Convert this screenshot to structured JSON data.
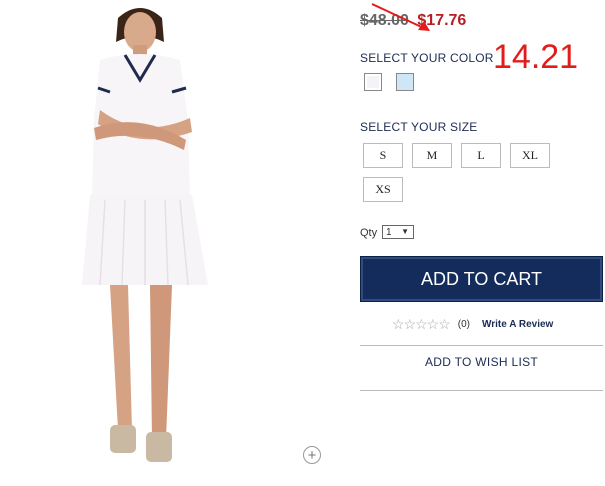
{
  "price": {
    "original": "$48.00",
    "sale": "$17.76"
  },
  "annotation": {
    "text": "14.21",
    "color": "#e21b1b"
  },
  "colors": {
    "label": "SELECT YOUR COLOR",
    "swatches": [
      {
        "name": "white",
        "hex": "#f3f4f8"
      },
      {
        "name": "light blue",
        "hex": "#cfe6f7"
      }
    ]
  },
  "sizes": {
    "label": "SELECT YOUR SIZE",
    "options": [
      "S",
      "M",
      "L",
      "XL",
      "XS"
    ]
  },
  "quantity": {
    "label": "Qty",
    "value": "1"
  },
  "cart": {
    "add_label": "ADD TO CART",
    "button_color": "#132c5b"
  },
  "reviews": {
    "count": "(0)",
    "write_label": "Write A Review",
    "stars": 0
  },
  "wishlist": {
    "label": "ADD TO WISH LIST"
  },
  "icons": {
    "zoom": "plus-circle-icon"
  }
}
